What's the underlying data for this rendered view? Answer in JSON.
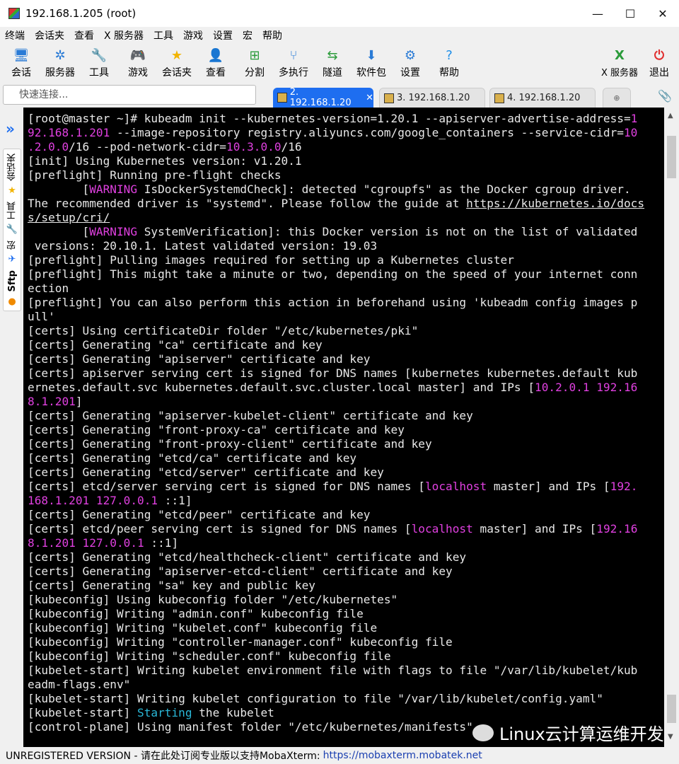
{
  "window": {
    "title": "192.168.1.205 (root)",
    "minimize_glyph": "—",
    "maximize_glyph": "☐",
    "close_glyph": "✕"
  },
  "menu": [
    "终端",
    "会话夹",
    "查看",
    "X 服务器",
    "工具",
    "游戏",
    "设置",
    "宏",
    "帮助"
  ],
  "toolbar": {
    "items": [
      {
        "label": "会话",
        "icon": "session-icon",
        "glyph": "🖥",
        "color": "#2a7bd6"
      },
      {
        "label": "服务器",
        "icon": "servers-icon",
        "glyph": "✲",
        "color": "#2a7bd6"
      },
      {
        "label": "工具",
        "icon": "tools-icon",
        "glyph": "🔧",
        "color": "#d33"
      },
      {
        "label": "游戏",
        "icon": "games-icon",
        "glyph": "🎮",
        "color": "#555"
      },
      {
        "label": "会话夹",
        "icon": "star-icon",
        "glyph": "★",
        "color": "#f2b400"
      },
      {
        "label": "查看",
        "icon": "view-icon",
        "glyph": "👤",
        "color": "#2a7bd6"
      },
      {
        "label": "分割",
        "icon": "split-icon",
        "glyph": "⊞",
        "color": "#2a9b3a"
      },
      {
        "label": "多执行",
        "icon": "multiexec-icon",
        "glyph": "⑂",
        "color": "#2a7bd6"
      },
      {
        "label": "隧道",
        "icon": "tunnel-icon",
        "glyph": "⇆",
        "color": "#2a9b3a"
      },
      {
        "label": "软件包",
        "icon": "package-icon",
        "glyph": "⬇",
        "color": "#2a7bd6"
      },
      {
        "label": "设置",
        "icon": "settings-icon",
        "glyph": "⚙",
        "color": "#2a7bd6"
      },
      {
        "label": "帮助",
        "icon": "help-icon",
        "glyph": "?",
        "color": "#1e8ee8"
      }
    ],
    "xserver": {
      "label": "X 服务器",
      "glyph": "X",
      "color": "#2a9b3a"
    },
    "exit": {
      "label": "退出",
      "glyph": "⏻",
      "color": "#e03030"
    }
  },
  "quick_connect": {
    "placeholder": "快速连接..."
  },
  "tabs": [
    {
      "label": "2. 192.168.1.20",
      "active": true
    },
    {
      "label": "3. 192.168.1.20",
      "active": false
    },
    {
      "label": "4. 192.168.1.20",
      "active": false
    }
  ],
  "tab_close_glyph": "✕",
  "sidebar": {
    "expand_glyph": "»",
    "sessions_label": "会话夹",
    "tools_label": "工具",
    "macros_label": "宏",
    "sftp_label": "Sftp"
  },
  "terminal": {
    "lines": [
      [
        {
          "t": "[root@master ~]# kubeadm init --kubernetes-version=1.20.1 --apiserver-advertise-address="
        },
        {
          "t": "1",
          "c": "mag"
        }
      ],
      [
        {
          "t": "92.168.1.201",
          "c": "mag"
        },
        {
          "t": " --image-repository registry.aliyuncs.com/google_containers --service-cidr="
        },
        {
          "t": "10",
          "c": "mag"
        }
      ],
      [
        {
          "t": ".2.0.0",
          "c": "mag"
        },
        {
          "t": "/16 --pod-network-cidr="
        },
        {
          "t": "10.3.0.0",
          "c": "mag"
        },
        {
          "t": "/16"
        }
      ],
      [
        {
          "t": "[init] Using Kubernetes version: v1.20.1"
        }
      ],
      [
        {
          "t": "[preflight] Running pre-flight checks"
        }
      ],
      [
        {
          "t": "        ["
        },
        {
          "t": "WARNING",
          "c": "mag"
        },
        {
          "t": " IsDockerSystemdCheck]: detected \"cgroupfs\" as the Docker cgroup driver."
        }
      ],
      [
        {
          "t": "The recommended driver is \"systemd\". Please follow the guide at "
        },
        {
          "t": "https://kubernetes.io/docs",
          "c": "url"
        }
      ],
      [
        {
          "t": "s/setup/cri/",
          "c": "url"
        }
      ],
      [
        {
          "t": "        ["
        },
        {
          "t": "WARNING",
          "c": "mag"
        },
        {
          "t": " SystemVerification]: this Docker version is not on the list of validated"
        }
      ],
      [
        {
          "t": " versions: 20.10.1. Latest validated version: 19.03"
        }
      ],
      [
        {
          "t": "[preflight] Pulling images required for setting up a Kubernetes cluster"
        }
      ],
      [
        {
          "t": "[preflight] This might take a minute or two, depending on the speed of your internet conn"
        }
      ],
      [
        {
          "t": "ection"
        }
      ],
      [
        {
          "t": "[preflight] You can also perform this action in beforehand using 'kubeadm config images p"
        }
      ],
      [
        {
          "t": "ull'"
        }
      ],
      [
        {
          "t": "[certs] Using certificateDir folder \"/etc/kubernetes/pki\""
        }
      ],
      [
        {
          "t": "[certs] Generating \"ca\" certificate and key"
        }
      ],
      [
        {
          "t": "[certs] Generating \"apiserver\" certificate and key"
        }
      ],
      [
        {
          "t": "[certs] apiserver serving cert is signed for DNS names [kubernetes kubernetes.default kub"
        }
      ],
      [
        {
          "t": "ernetes.default.svc kubernetes.default.svc.cluster.local master] and IPs ["
        },
        {
          "t": "10.2.0.1 192.16",
          "c": "mag"
        }
      ],
      [
        {
          "t": "8.1.201",
          "c": "mag"
        },
        {
          "t": "]"
        }
      ],
      [
        {
          "t": "[certs] Generating \"apiserver-kubelet-client\" certificate and key"
        }
      ],
      [
        {
          "t": "[certs] Generating \"front-proxy-ca\" certificate and key"
        }
      ],
      [
        {
          "t": "[certs] Generating \"front-proxy-client\" certificate and key"
        }
      ],
      [
        {
          "t": "[certs] Generating \"etcd/ca\" certificate and key"
        }
      ],
      [
        {
          "t": "[certs] Generating \"etcd/server\" certificate and key"
        }
      ],
      [
        {
          "t": "[certs] etcd/server serving cert is signed for DNS names ["
        },
        {
          "t": "localhost",
          "c": "mag"
        },
        {
          "t": " master] and IPs ["
        },
        {
          "t": "192.",
          "c": "mag"
        }
      ],
      [
        {
          "t": "168.1.201 127.0.0.1",
          "c": "mag"
        },
        {
          "t": " ::1]"
        }
      ],
      [
        {
          "t": "[certs] Generating \"etcd/peer\" certificate and key"
        }
      ],
      [
        {
          "t": "[certs] etcd/peer serving cert is signed for DNS names ["
        },
        {
          "t": "localhost",
          "c": "mag"
        },
        {
          "t": " master] and IPs ["
        },
        {
          "t": "192.16",
          "c": "mag"
        }
      ],
      [
        {
          "t": "8.1.201 127.0.0.1",
          "c": "mag"
        },
        {
          "t": " ::1]"
        }
      ],
      [
        {
          "t": "[certs] Generating \"etcd/healthcheck-client\" certificate and key"
        }
      ],
      [
        {
          "t": "[certs] Generating \"apiserver-etcd-client\" certificate and key"
        }
      ],
      [
        {
          "t": "[certs] Generating \"sa\" key and public key"
        }
      ],
      [
        {
          "t": "[kubeconfig] Using kubeconfig folder \"/etc/kubernetes\""
        }
      ],
      [
        {
          "t": "[kubeconfig] Writing \"admin.conf\" kubeconfig file"
        }
      ],
      [
        {
          "t": "[kubeconfig] Writing \"kubelet.conf\" kubeconfig file"
        }
      ],
      [
        {
          "t": "[kubeconfig] Writing \"controller-manager.conf\" kubeconfig file"
        }
      ],
      [
        {
          "t": "[kubeconfig] Writing \"scheduler.conf\" kubeconfig file"
        }
      ],
      [
        {
          "t": "[kubelet-start] Writing kubelet environment file with flags to file \"/var/lib/kubelet/kub"
        }
      ],
      [
        {
          "t": "eadm-flags.env\""
        }
      ],
      [
        {
          "t": "[kubelet-start] Writing kubelet configuration to file \"/var/lib/kubelet/config.yaml\""
        }
      ],
      [
        {
          "t": "[kubelet-start] "
        },
        {
          "t": "Starting",
          "c": "cyan"
        },
        {
          "t": " the kubelet"
        }
      ],
      [
        {
          "t": "[control-plane] Using manifest folder \"/etc/kubernetes/manifests\""
        }
      ]
    ]
  },
  "watermark": "Linux云计算运维开发",
  "status": {
    "text": "UNREGISTERED VERSION  -  请在此处订阅专业版以支持MobaXterm:",
    "link": "https://mobaxterm.mobatek.net"
  }
}
